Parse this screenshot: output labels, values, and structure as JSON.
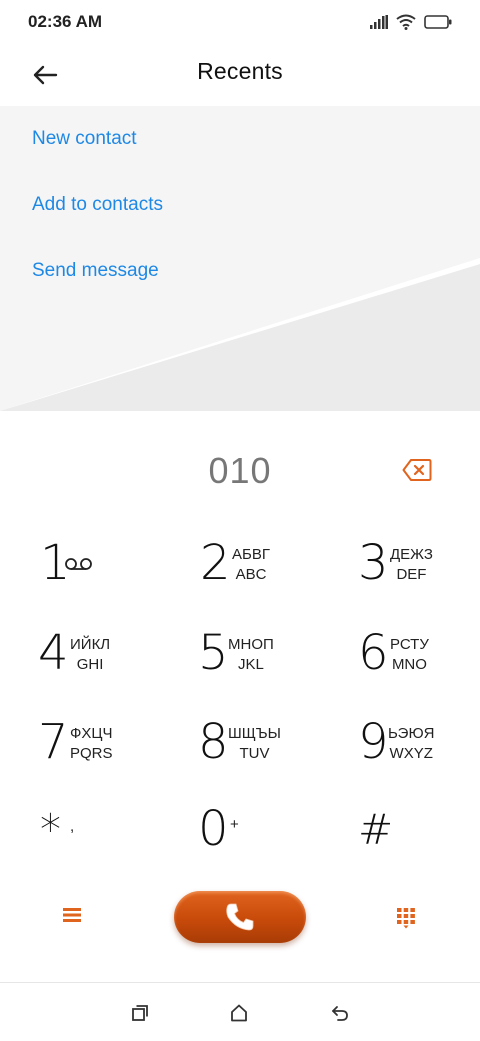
{
  "status_bar": {
    "time": "02:36 AM",
    "icons": [
      "signal-icon",
      "wifi-icon",
      "battery-icon"
    ]
  },
  "header": {
    "title": "Recents",
    "back_icon": "back-arrow-icon"
  },
  "options": {
    "new_contact": "New contact",
    "add_to_contacts": "Add to contacts",
    "send_message": "Send message"
  },
  "dialer": {
    "entered_number": "010",
    "backspace_icon": "backspace-icon"
  },
  "keypad": {
    "keys": [
      {
        "num": "1",
        "line1": "",
        "line2": "",
        "icon": "voicemail-icon"
      },
      {
        "num": "2",
        "line1": "АБВГ",
        "line2": "ABC"
      },
      {
        "num": "3",
        "line1": "ДЕЖЗ",
        "line2": "DEF"
      },
      {
        "num": "4",
        "line1": "ИЙКЛ",
        "line2": "GHI"
      },
      {
        "num": "5",
        "line1": "МНОП",
        "line2": "JKL"
      },
      {
        "num": "6",
        "line1": "РСТУ",
        "line2": "MNO"
      },
      {
        "num": "7",
        "line1": "ФХЦЧ",
        "line2": "PQRS"
      },
      {
        "num": "8",
        "line1": "ШЩЪЫ",
        "line2": "TUV"
      },
      {
        "num": "9",
        "line1": "ЬЭЮЯ",
        "line2": "WXYZ"
      },
      {
        "num": "*",
        "line1": ",",
        "line2": ""
      },
      {
        "num": "0",
        "line1": "+",
        "line2": ""
      },
      {
        "num": "#",
        "line1": "",
        "line2": ""
      }
    ]
  },
  "actions": {
    "menu_icon": "menu-icon",
    "call_icon": "phone-icon",
    "dialpad_icon": "dialpad-icon"
  },
  "nav_bar": {
    "icons": [
      "recent-apps-icon",
      "home-icon",
      "back-icon"
    ]
  },
  "colors": {
    "accent": "#e0641e",
    "link": "#1e88e5"
  }
}
